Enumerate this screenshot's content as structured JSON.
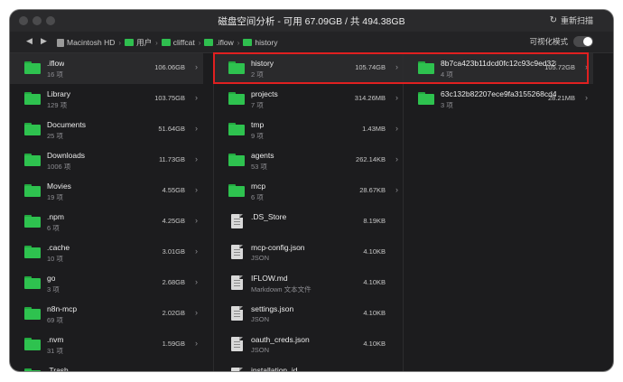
{
  "window": {
    "title": "磁盘空间分析 - 可用 67.09GB / 共 494.38GB",
    "rescan_label": "重新扫描",
    "rescan_icon": "refresh-icon"
  },
  "pathbar": {
    "back_glyph": "◀",
    "forward_glyph": "▶",
    "crumbs": [
      "Macintosh HD",
      "用户",
      "cliffcat",
      ".iflow",
      "history"
    ],
    "visualize_label": "可视化模式",
    "visualize_on": false
  },
  "columns": [
    {
      "items": [
        {
          "name": ".iflow",
          "sub": "16 项",
          "size": "106.06GB",
          "selected": true
        },
        {
          "name": "Library",
          "sub": "129 项",
          "size": "103.75GB"
        },
        {
          "name": "Documents",
          "sub": "25 项",
          "size": "51.64GB"
        },
        {
          "name": "Downloads",
          "sub": "1006 项",
          "size": "11.73GB"
        },
        {
          "name": "Movies",
          "sub": "19 项",
          "size": "4.55GB"
        },
        {
          "name": ".npm",
          "sub": "6 项",
          "size": "4.25GB"
        },
        {
          "name": ".cache",
          "sub": "10 项",
          "size": "3.01GB"
        },
        {
          "name": "go",
          "sub": "3 项",
          "size": "2.68GB"
        },
        {
          "name": "n8n-mcp",
          "sub": "69 项",
          "size": "2.02GB"
        },
        {
          "name": ".nvm",
          "sub": "31 项",
          "size": "1.59GB"
        },
        {
          "name": ".Trash",
          "sub": "",
          "size": ""
        }
      ]
    },
    {
      "items": [
        {
          "name": "history",
          "sub": "2 项",
          "size": "105.74GB",
          "selected": true,
          "kind": "folder"
        },
        {
          "name": "projects",
          "sub": "7 项",
          "size": "314.26MB",
          "kind": "folder"
        },
        {
          "name": "tmp",
          "sub": "9 项",
          "size": "1.43MB",
          "kind": "folder"
        },
        {
          "name": "agents",
          "sub": "53 项",
          "size": "262.14KB",
          "kind": "folder"
        },
        {
          "name": "mcp",
          "sub": "6 项",
          "size": "28.67KB",
          "kind": "folder"
        },
        {
          "name": ".DS_Store",
          "sub": "",
          "size": "8.19KB",
          "kind": "file"
        },
        {
          "name": "mcp-config.json",
          "sub": "JSON",
          "size": "4.10KB",
          "kind": "doc"
        },
        {
          "name": "IFLOW.md",
          "sub": "Markdown 文本文件",
          "size": "4.10KB",
          "kind": "doc"
        },
        {
          "name": "settings.json",
          "sub": "JSON",
          "size": "4.10KB",
          "kind": "doc"
        },
        {
          "name": "oauth_creds.json",
          "sub": "JSON",
          "size": "4.10KB",
          "kind": "doc"
        },
        {
          "name": "installation_id",
          "sub": "",
          "size": "",
          "kind": "doc"
        }
      ]
    },
    {
      "items": [
        {
          "name": "8b7ca423b11dcd0fc12c93c9ed328",
          "sub": "4 项",
          "size": "105.72GB",
          "selected": true
        },
        {
          "name": "63c132b82207ece9fa3155268cd4!",
          "sub": "3 项",
          "size": "28.21MB"
        }
      ]
    }
  ],
  "colors": {
    "accent_folder": "#2ec24f",
    "highlight_box": "#e02020",
    "window_bg": "#1c1c1e"
  }
}
